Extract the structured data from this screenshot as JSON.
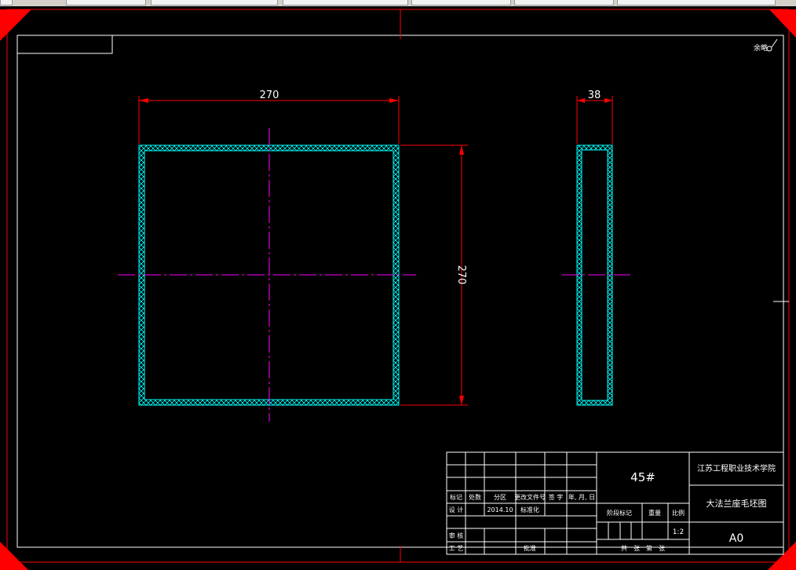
{
  "drawing": {
    "surface_finish_note": "余略",
    "dimensions": {
      "front_width": "270",
      "front_height": "270",
      "side_thickness": "38"
    }
  },
  "title_block": {
    "part_number": "45#",
    "school": "江苏工程职业技术学院",
    "drawing_title": "大法兰座毛坯图",
    "sheet_size": "A0",
    "scale": "1:2",
    "scale_label": "比例",
    "weight_label": "重量",
    "stage_label": "阶段标记",
    "sheets_label": "共　张　第　张",
    "date": "2014.10",
    "standardization_label": "标准化",
    "approval_label": "批准",
    "design_label": "设 计",
    "review_label": "审 核",
    "process_label": "工 艺",
    "rev_headers": [
      "标记",
      "处数",
      "分区",
      "更改文件号",
      "签 字",
      "年, 月, 日"
    ]
  },
  "colors": {
    "background": "#000000",
    "border": "#ff0000",
    "object": "#00ffff",
    "centerline": "#ff00ff",
    "text": "#ffffff"
  }
}
